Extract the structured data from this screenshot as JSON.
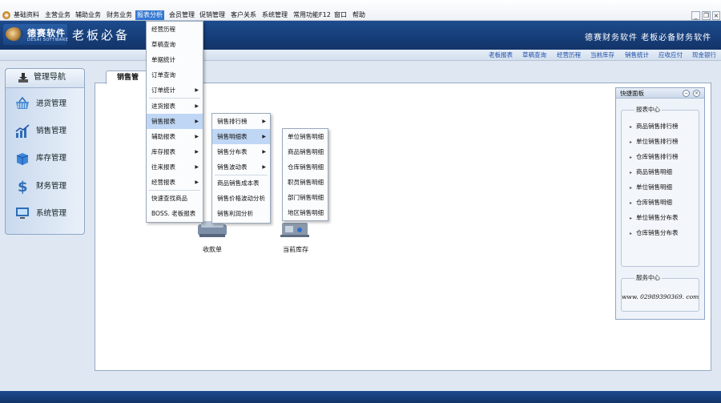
{
  "menubar": {
    "logo_glyph": "◉",
    "items": [
      "基础资料",
      "主营业务",
      "辅助业务",
      "财务业务",
      "报表分析",
      "会员管理",
      "促销管理",
      "客户关系",
      "系统管理",
      "常用功能F12",
      "窗口",
      "帮助"
    ],
    "window_buttons": [
      "_",
      "❐",
      "×"
    ]
  },
  "banner": {
    "logo_cn": "德赛软件",
    "logo_en": "DESAI SOFTWARE",
    "slogan": "老板必备",
    "right_text": "德赛财务软件 老板必备财务软件"
  },
  "quickbar": {
    "links": [
      "老板报表",
      "草稿查询",
      "经营历程",
      "当前库存",
      "销售统计",
      "应收应付",
      "现金银行"
    ]
  },
  "nav": {
    "title": "管理导航",
    "items": [
      {
        "label": "进货管理",
        "icon": "basket-icon"
      },
      {
        "label": "销售管理",
        "icon": "chart-icon"
      },
      {
        "label": "库存管理",
        "icon": "box-icon"
      },
      {
        "label": "财务管理",
        "icon": "dollar-icon"
      },
      {
        "label": "系统管理",
        "icon": "monitor-icon"
      }
    ]
  },
  "main": {
    "tab_label": "销售管",
    "desktop_icons": [
      {
        "label": "收款单",
        "icon": "cash-register-icon"
      },
      {
        "label": "当前库存",
        "icon": "warehouse-icon"
      }
    ]
  },
  "quick_panel": {
    "title": "快捷面板",
    "report_center": {
      "legend": "报表中心",
      "links": [
        "商品销售排行榜",
        "单位销售排行榜",
        "仓库销售排行榜",
        "商品销售明细",
        "单位销售明细",
        "仓库销售明细",
        "单位销售分布表",
        "仓库销售分布表"
      ]
    },
    "service_center": {
      "legend": "服务中心",
      "phone": "www. 02989390369. com"
    }
  },
  "menus": {
    "report_menu": [
      "经营历程",
      "草稿查询",
      "单据统计",
      "订单查询",
      "订单统计",
      "进货报表",
      "销售报表",
      "辅助报表",
      "库存报表",
      "往来报表",
      "经营报表",
      "快速查找商品",
      "BOSS. 老板报表"
    ],
    "sales_submenu": [
      "销售排行榜",
      "销售明细表",
      "销售分布表",
      "销售波动表",
      "商品销售成本表",
      "销售价格波动分析",
      "销售利润分析"
    ],
    "detail_submenu": [
      "单位销售明细",
      "商品销售明细",
      "仓库销售明细",
      "职员销售明细",
      "部门销售明细",
      "地区销售明细"
    ]
  },
  "colors": {
    "accent": "#3578d1",
    "banner": "#1d4b8c",
    "highlight": "#bfd7f5"
  }
}
